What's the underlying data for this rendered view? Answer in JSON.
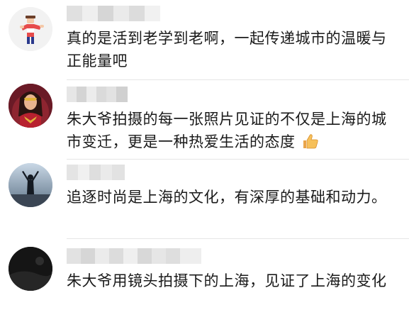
{
  "comments": [
    {
      "text": "真的是活到老学到老啊，一起传递城市的温暖与正能量吧",
      "avatar_icon": "lego-figure-avatar",
      "username_blurred": true
    },
    {
      "text": "朱大爷拍摄的每一张照片见证的不仅是上海的城市变迁，更是一种热爱生活的态度",
      "avatar_icon": "wonder-woman-avatar",
      "username_blurred": true,
      "emoji": "thumbs-up-icon"
    },
    {
      "text": "追逐时尚是上海的文化，有深厚的基础和动力。",
      "avatar_icon": "silhouette-person-avatar",
      "username_blurred": true
    },
    {
      "text": "朱大爷用镜头拍摄下的上海，见证了上海的变化",
      "avatar_icon": "dark-photo-avatar",
      "username_blurred": true
    }
  ],
  "colors": {
    "text": "#1a1a1a",
    "divider": "#e6e6e6",
    "username_blur": "#d9d9d9"
  }
}
